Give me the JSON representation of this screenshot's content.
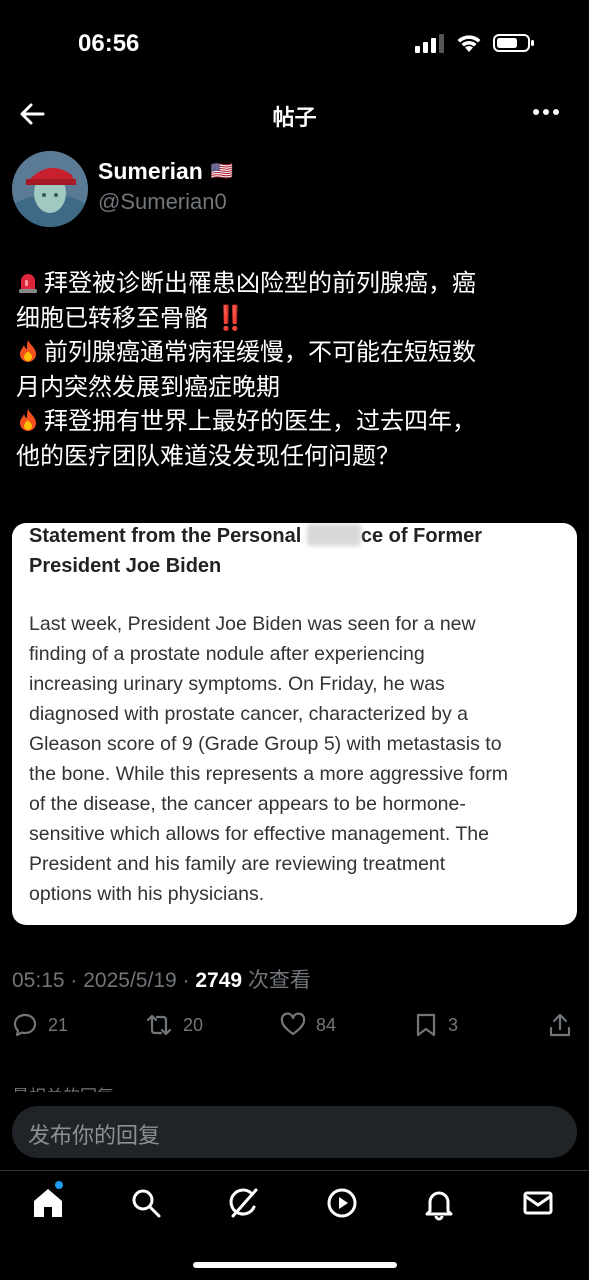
{
  "status_bar": {
    "time": "06:56"
  },
  "header": {
    "title": "帖子"
  },
  "author": {
    "name": "Sumerian",
    "flag": "🇺🇸",
    "handle": "@Sumerian0"
  },
  "post": {
    "lines": [
      {
        "emoji": "rotating-light",
        "text": "拜登被诊断出罹患凶险型的前列腺癌，癌"
      },
      {
        "emoji": "",
        "text": "细胞已转移至骨骼 ‼️"
      },
      {
        "emoji": "fire",
        "text": "前列腺癌通常病程缓慢，不可能在短短数"
      },
      {
        "emoji": "",
        "text": "月内突然发展到癌症晚期"
      },
      {
        "emoji": "fire",
        "text": "拜登拥有世界上最好的医生，过去四年，"
      },
      {
        "emoji": "",
        "text": "他的医疗团队难道没发现任何问题？"
      }
    ]
  },
  "statement": {
    "title_part1": "Statement from the Personal",
    "title_part2": "ce of Former",
    "title_line2": "President Joe Biden",
    "body_lines": [
      "Last week, President Joe Biden was seen for a new",
      "finding of a prostate nodule after experiencing",
      "increasing urinary symptoms. On Friday, he was",
      "diagnosed with prostate cancer, characterized by a",
      "Gleason score of 9 (Grade Group 5) with metastasis to",
      "the bone. While this represents a more aggressive form",
      "of the disease, the cancer appears to be hormone-",
      "sensitive which allows for effective management. The",
      "President and his family are reviewing treatment",
      "options with his physicians."
    ]
  },
  "meta": {
    "time": "05:15",
    "date": "2025/5/19",
    "views": "2749",
    "views_label": "次查看"
  },
  "actions": {
    "replies": "21",
    "reposts": "20",
    "likes": "84",
    "bookmarks": "3"
  },
  "related_label": "最相关的回复",
  "reply": {
    "placeholder": "发布你的回复"
  },
  "colors": {
    "accent": "#1d9bf0",
    "muted": "#71767b",
    "background": "#000000"
  }
}
